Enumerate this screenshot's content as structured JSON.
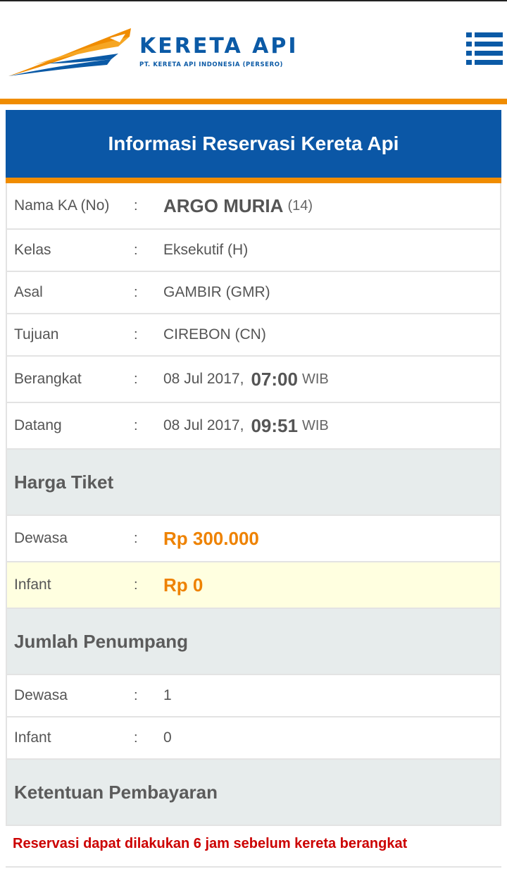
{
  "header": {
    "brand_name": "KERETA API",
    "brand_sub": "PT. KERETA API INDONESIA (PERSERO)",
    "menu_icon": "hamburger-menu-icon"
  },
  "colors": {
    "primary_blue": "#0b57a6",
    "accent_orange": "#f08c00",
    "price_orange": "#ee8200",
    "notice_red": "#cc0000",
    "highlight_yellow": "#ffffe0",
    "section_gray": "#e7ecec"
  },
  "card": {
    "title": "Informasi Reservasi Kereta Api"
  },
  "train": {
    "name_label": "Nama KA (No)",
    "name": "ARGO MURIA",
    "number": "(14)",
    "class_label": "Kelas",
    "class": "Eksekutif (H)",
    "origin_label": "Asal",
    "origin": "GAMBIR (GMR)",
    "destination_label": "Tujuan",
    "destination": "CIREBON (CN)",
    "depart_label": "Berangkat",
    "depart_date": "08 Jul 2017,",
    "depart_time": "07:00",
    "depart_tz": "WIB",
    "arrive_label": "Datang",
    "arrive_date": "08 Jul 2017,",
    "arrive_time": "09:51",
    "arrive_tz": "WIB"
  },
  "separator": ":",
  "ticket_price": {
    "heading": "Harga Tiket",
    "adult_label": "Dewasa",
    "adult_price": "Rp 300.000",
    "infant_label": "Infant",
    "infant_price": "Rp 0"
  },
  "passengers": {
    "heading": "Jumlah Penumpang",
    "adult_label": "Dewasa",
    "adult_count": "1",
    "infant_label": "Infant",
    "infant_count": "0"
  },
  "payment": {
    "heading": "Ketentuan Pembayaran",
    "notice": "Reservasi dapat dilakukan 6 jam sebelum kereta berangkat"
  }
}
